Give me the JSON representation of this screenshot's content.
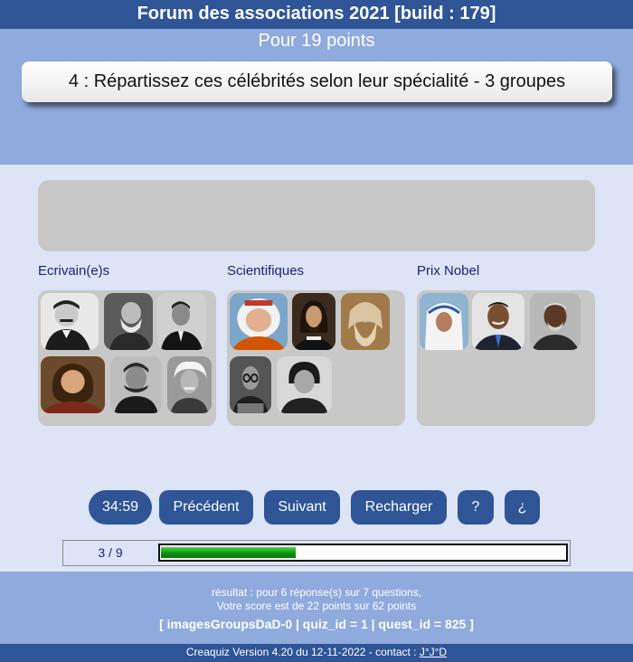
{
  "header": {
    "title": "Forum des associations 2021 [build : 179]",
    "points": "Pour 19 points",
    "question": "4 : Répartissez ces célébrités selon leur spécialité - 3 groupes"
  },
  "groups": [
    {
      "title": "Ecrivain(e)s",
      "photos": [
        "portrait-man-mustache",
        "portrait-old-man-beard",
        "portrait-man-suit",
        "portrait-man-wig",
        "portrait-man-whiskers",
        "portrait-man-white-hair"
      ]
    },
    {
      "title": "Scientifiques",
      "photos": [
        "portrait-cosmonaut",
        "portrait-man-long-hair",
        "portrait-old-man-long-beard",
        "portrait-man-glasses",
        "portrait-woman-dark-hair"
      ]
    },
    {
      "title": "Prix Nobel",
      "photos": [
        "portrait-nun-veil",
        "portrait-man-smiling-suit",
        "portrait-man-grey-beard"
      ]
    }
  ],
  "controls": {
    "timer": "34:59",
    "previous": "Précédent",
    "next": "Suivant",
    "reload": "Recharger",
    "help": "?",
    "help_inverted": "¿"
  },
  "progress": {
    "label": "3 / 9",
    "fraction": 0.333
  },
  "results": {
    "line1": "résultat : pour 6 réponse(s) sur 7 questions,",
    "line2": "Votre score est de 22 points sur 62 points",
    "meta": "[ imagesGroupsDaD-0 | quiz_id = 1 | quest_id = 825 ]"
  },
  "footer": {
    "version": "Creaquiz Version 4.20 du 12-11-2022 - contact : ",
    "contact_link": "J°J°D"
  },
  "colors": {
    "dark_blue": "#2f5597",
    "mid_blue": "#8faadc",
    "light_blue": "#dce4f5",
    "gray_zone": "#c8c8c8",
    "progress_green": "#0a8f0a"
  }
}
